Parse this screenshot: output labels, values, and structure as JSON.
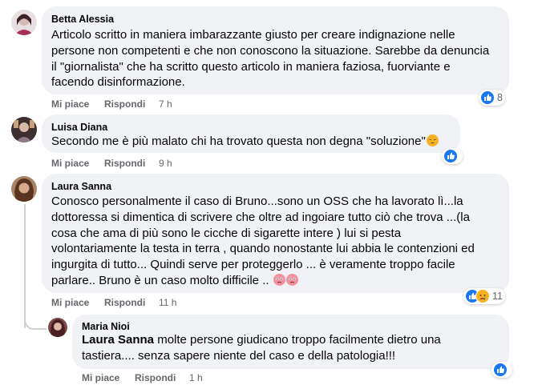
{
  "comments": [
    {
      "author": "Betta Alessia",
      "lines": [
        "Articolo scritto in maniera imbarazzante giusto per creare indignazione nelle",
        "persone non competenti e che non conoscono la situazione. Sarebbe da denuncia",
        "il \"giornalista\" che ha scritto questo articolo in maniera faziosa, fuorviante e",
        "facendo disinformazione."
      ],
      "like_label": "Mi piace",
      "reply_label": "Rispondi",
      "time": "7 h",
      "reaction_count": "8",
      "reaction_icons": [
        "like-icon"
      ]
    },
    {
      "author": "Luisa Diana",
      "lines": [
        "Secondo me è più malato chi ha trovato questa non degna \"soluzione\""
      ],
      "trailing_emoji": "pensive-face-emoji",
      "like_label": "Mi piace",
      "reply_label": "Rispondi",
      "time": "9 h",
      "reaction_count": "",
      "reaction_icons": [
        "like-icon"
      ]
    },
    {
      "author": "Laura Sanna",
      "lines": [
        "Conosco personalmente il caso di Bruno...sono un OSS che ha lavorato lì...la",
        "dottoressa si dimentica di scrivere che oltre ad ingoiare tutto ciò che trova ...(la",
        "cosa che ama di più sono le cicche di sigarette intere ) lui si pesta",
        "volontariamente la testa in terra , quando nonostante lui abbia le contenzioni ed",
        "ingurgita di tutto... Quindi serve per proteggerlo ... è veramente troppo facile",
        "parlare.. Bruno è un caso molto difficile .."
      ],
      "trailing_emojis": [
        "crying-face-emoji",
        "crying-face-emoji"
      ],
      "like_label": "Mi piace",
      "reply_label": "Rispondi",
      "time": "11 h",
      "reaction_count": "11",
      "reaction_icons": [
        "like-icon",
        "sad-icon"
      ]
    }
  ],
  "reply": {
    "author": "Maria Nioi",
    "mention": "Laura Sanna",
    "line1": " molte persone giudicano troppo facilmente dietro una",
    "line2": "tastiera.... senza sapere niente del caso e della patologia!!!",
    "like_label": "Mi piace",
    "reply_label": "Rispondi",
    "time": "1 h",
    "reaction_count": "",
    "reaction_icons": [
      "like-icon"
    ]
  },
  "colors": {
    "bubble": "#f0f2f5",
    "like_blue": "#1877f2",
    "meta_gray": "#65676b",
    "sad_yellow": "#f7b125"
  }
}
